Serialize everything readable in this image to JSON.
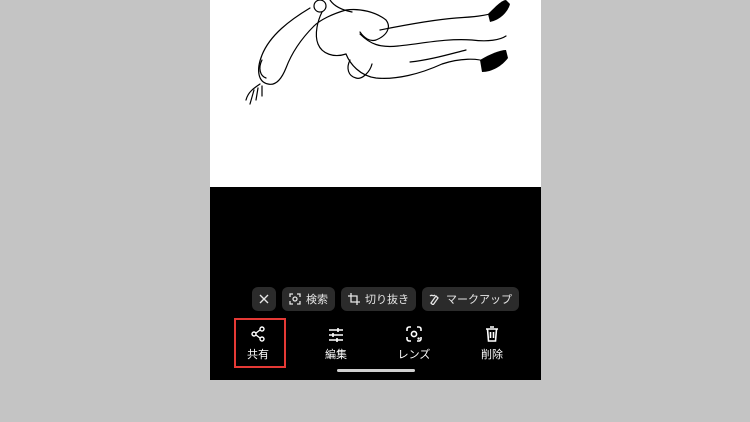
{
  "chips": {
    "close": "×",
    "search": "検索",
    "crop": "切り抜き",
    "markup": "マークアップ"
  },
  "actions": {
    "share": "共有",
    "edit": "編集",
    "lens": "レンズ",
    "delete": "削除"
  },
  "colors": {
    "background": "#c4c4c4",
    "screen": "#000000",
    "chip": "#2b2b2b",
    "highlight": "#e53935"
  },
  "icons": [
    "close-icon",
    "search-lens-icon",
    "crop-icon",
    "markup-icon",
    "share-icon",
    "edit-sliders-icon",
    "lens-icon",
    "delete-icon"
  ]
}
